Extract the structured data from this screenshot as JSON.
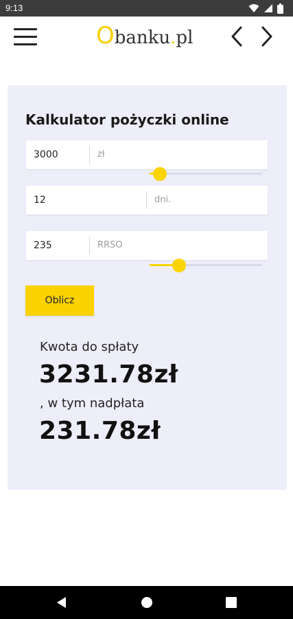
{
  "status_bar": {
    "time": "9:13",
    "icons": [
      "wifi-icon",
      "cellular-signal-icon",
      "battery-icon"
    ]
  },
  "header": {
    "logo": {
      "o": "O",
      "text": "banku",
      "dot": ".",
      "suffix": "pl"
    },
    "menu_icon": "hamburger-menu-icon",
    "back_icon": "chevron-left-icon",
    "forward_icon": "chevron-right-icon"
  },
  "calculator": {
    "title": "Kalkulator pożyczki online",
    "amount": {
      "value": "3000",
      "unit": "zł",
      "slider_level": 0.09
    },
    "days": {
      "value": "12",
      "unit": "dni."
    },
    "rrso": {
      "value": "235",
      "unit": "RRSO",
      "slider_level": 0.26
    },
    "button_label": "Oblicz",
    "result": {
      "label_total": "Kwota do spłaty",
      "total": "3231.78zł",
      "label_overpay": ", w tym nadpłata",
      "overpay": "231.78zł"
    }
  },
  "colors": {
    "accent": "#fad200",
    "card_background": "#eeeefa",
    "status_bar": "#3c3c3c",
    "nav_bar": "#000000"
  },
  "system_nav": {
    "buttons": [
      "back-triangle-icon",
      "home-circle-icon",
      "recents-square-icon"
    ]
  }
}
